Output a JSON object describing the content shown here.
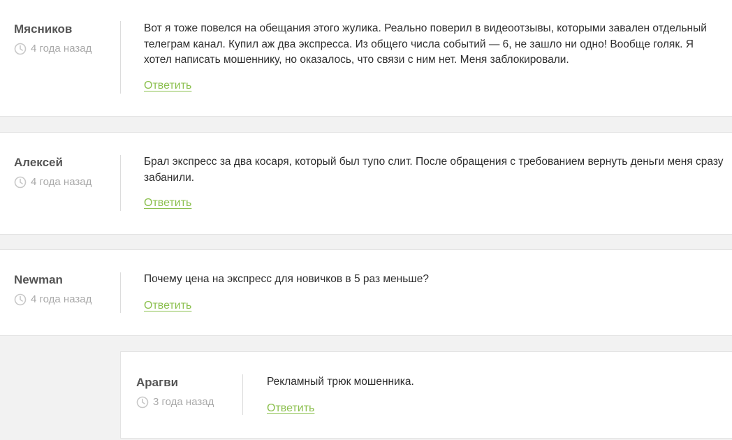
{
  "comments": [
    {
      "author": "Мясников",
      "date": "4 года назад",
      "text": "Вот я тоже повелся на обещания этого жулика. Реально поверил в видеоотзывы, которыми завален отдельный телеграм канал. Купил аж два экспресса. Из общего числа событий — 6, не зашло ни одно! Вообще голяк. Я хотел написать мошеннику, но оказалось, что связи с ним нет. Меня заблокировали.",
      "reply_label": "Ответить"
    },
    {
      "author": "Алексей",
      "date": "4 года назад",
      "text": "Брал экспресс за два косаря, который был тупо слит. После обращения с требованием вернуть деньги меня сразу забанили.",
      "reply_label": "Ответить"
    },
    {
      "author": "Newman",
      "date": "4 года назад",
      "text": "Почему цена на экспресс для новичков в 5 раз меньше?",
      "reply_label": "Ответить"
    },
    {
      "author": "Арагви",
      "date": "3 года назад",
      "text": "Рекламный трюк мошенника.",
      "reply_label": "Ответить"
    }
  ],
  "colors": {
    "link": "#8cc04f",
    "author": "#555555",
    "date": "#a9a9a9",
    "background": "#f2f2f2"
  },
  "icons": {
    "date": "clock-icon"
  }
}
